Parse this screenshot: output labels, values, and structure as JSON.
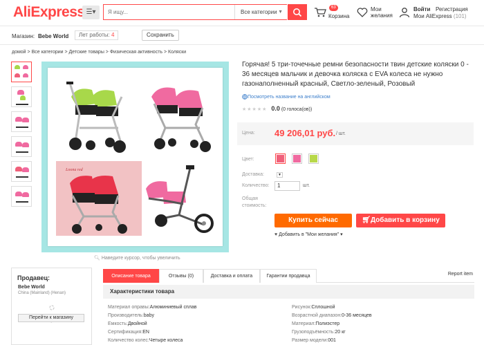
{
  "header": {
    "logo": "AliExpress",
    "logo_tm": "™",
    "search_placeholder": "Я ищу...",
    "search_category": "Все категории",
    "cart_count": "63",
    "cart_label": "Корзина",
    "wish_line1": "Мои",
    "wish_line2": "желания",
    "login": "Войти",
    "register": "Регистрация",
    "my_aliexpress": "Мои AliExpress",
    "my_count": "(101)"
  },
  "store": {
    "label": "Магазин:",
    "name": "Bebe World",
    "years_label": "Лет работы:",
    "years": "4",
    "save": "Сохранить"
  },
  "breadcrumb": "домой > Все категории > Детские товары > Физическая активность > Коляски",
  "gallery": {
    "zoom_hint": "Наведите курсор, чтобы увеличить",
    "photo_text": "Loona red"
  },
  "product": {
    "title": "Горячая! 5 три-точечные ремни безопасности твин детские коляски 0 - 36 месяцев мальчик и девочка коляска с EVA колеса не нужно газонаполненный красный, Светло-зеленый, Розовый",
    "translate": "Посмотреть название на английском",
    "stars": "★★★★★",
    "rating": "0.0",
    "votes": "(0 голоса(ов))",
    "price_label": "Цена:",
    "price": "49 206,01 руб.",
    "per": "/ шт.",
    "color_label": "Цвет:",
    "shipping_label": "Доставка:",
    "qty_label": "Количество:",
    "qty": "1",
    "qty_unit": "шт.",
    "total_label_1": "Общая",
    "total_label_2": "стоимость:",
    "buy_now": "Купить сейчас",
    "add_to_cart": "Добавить в корзину",
    "add_wish": "Добавить в \"Мои желания\"",
    "colors": [
      "#f0607a",
      "#f06aa0",
      "#b8d84a"
    ]
  },
  "seller": {
    "heading": "Продавец:",
    "name": "Bebe World",
    "location": "China (Mainland) (Henan)",
    "goto": "Перейти к магазину"
  },
  "tabs": [
    "Описание товара",
    "Отзывы (0)",
    "Доставка и оплата",
    "Гарантии продавца"
  ],
  "report": "Report item",
  "specs_heading": "Характеристики товара",
  "specs_left": [
    {
      "k": "Материал оправы:",
      "v": "Алюминиевый сплав"
    },
    {
      "k": "Производитель:",
      "v": "baby"
    },
    {
      "k": "Емкость:",
      "v": "Двойной"
    },
    {
      "k": "Сертификация:",
      "v": "EN"
    },
    {
      "k": "Количество колес:",
      "v": "Четыре колеса"
    }
  ],
  "specs_right": [
    {
      "k": "Рисунок:",
      "v": "Сплошной"
    },
    {
      "k": "Возрастной диапазон:",
      "v": "0-36 месяцев"
    },
    {
      "k": "Материал:",
      "v": "Полиэстер"
    },
    {
      "k": "Грузоподъёмность:",
      "v": "20 кг"
    },
    {
      "k": "Размер модели:",
      "v": "001"
    }
  ]
}
